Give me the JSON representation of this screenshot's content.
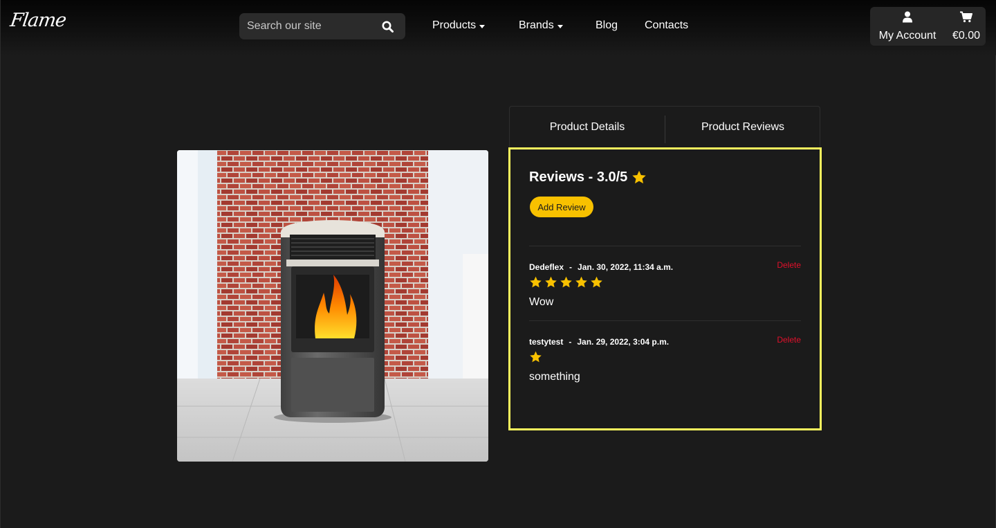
{
  "brand": {
    "logo": "Flame"
  },
  "search": {
    "placeholder": "Search our site"
  },
  "nav": {
    "products": "Products",
    "brands": "Brands",
    "blog": "Blog",
    "contacts": "Contacts"
  },
  "account": {
    "label": "My Account",
    "cart_total": "€0.00"
  },
  "tabs": {
    "details": "Product Details",
    "reviews": "Product Reviews"
  },
  "reviews_panel": {
    "title": "Reviews - 3.0/5",
    "add_review": "Add Review",
    "delete_label": "Delete",
    "items": [
      {
        "author": "Dedeflex",
        "separator": "-",
        "date": "Jan. 30, 2022, 11:34 a.m.",
        "rating": 5,
        "text": "Wow"
      },
      {
        "author": "testytest",
        "separator": "-",
        "date": "Jan. 29, 2022, 3:04 p.m.",
        "rating": 1,
        "text": "something"
      }
    ]
  },
  "colors": {
    "background": "#1b1b1b",
    "accent": "#f8c100",
    "star": "#f8c100",
    "delete": "#e0102b",
    "highlight_border": "#fdf95e"
  }
}
